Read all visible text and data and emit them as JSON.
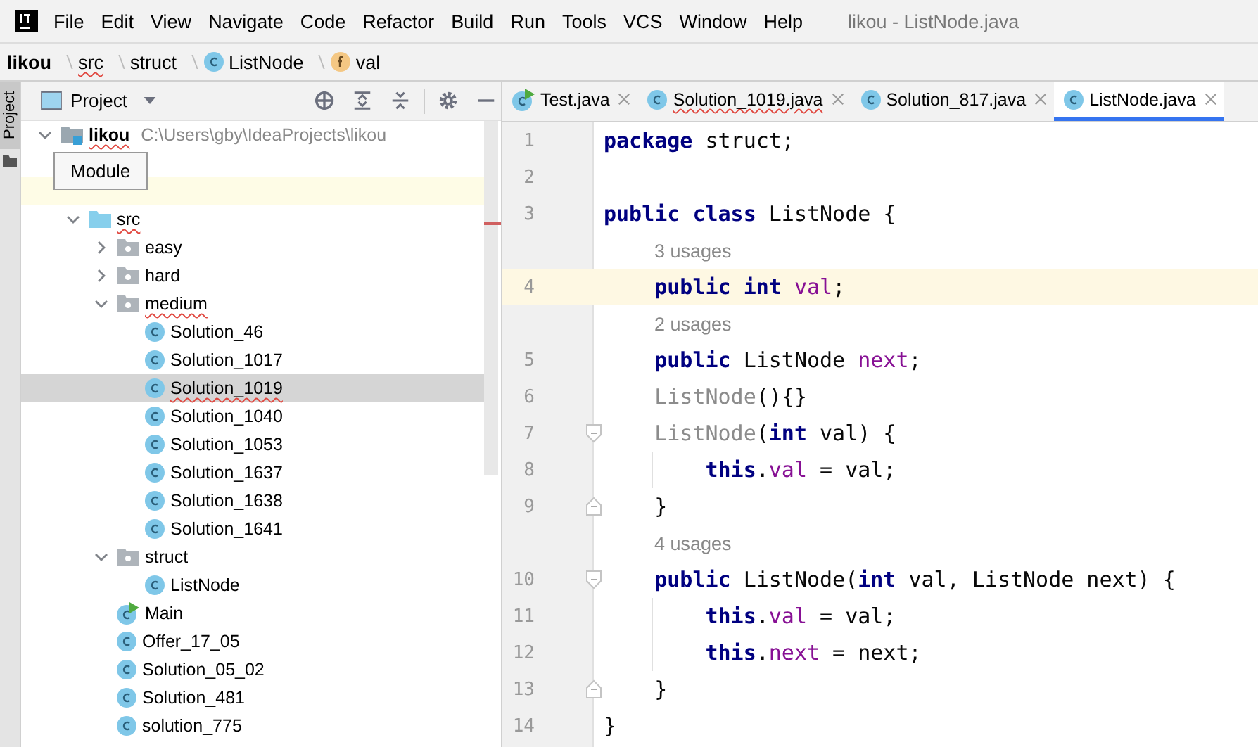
{
  "menu": [
    "File",
    "Edit",
    "View",
    "Navigate",
    "Code",
    "Refactor",
    "Build",
    "Run",
    "Tools",
    "VCS",
    "Window",
    "Help"
  ],
  "window": {
    "title": "likou - ListNode.java"
  },
  "breadcrumb": [
    {
      "label": "likou",
      "kind": "module",
      "error": false
    },
    {
      "label": "src",
      "kind": "folder",
      "error": true
    },
    {
      "label": "struct",
      "kind": "folder",
      "error": false
    },
    {
      "label": "ListNode",
      "kind": "class",
      "error": false
    },
    {
      "label": "val",
      "kind": "field",
      "error": false
    }
  ],
  "side_strip": {
    "label": "Project"
  },
  "project": {
    "title": "Project",
    "tooltip": "Module",
    "tree": [
      {
        "label": "likou",
        "path": "C:\\Users\\gby\\IdeaProjects\\likou",
        "kind": "module",
        "expanded": true,
        "selected": false,
        "error": true,
        "children": [
          {
            "kind": "covered",
            "highlighted": false
          },
          {
            "kind": "covered",
            "highlighted": true
          },
          {
            "label": "src",
            "kind": "source",
            "expanded": true,
            "selected": false,
            "error": true,
            "children": [
              {
                "label": "easy",
                "kind": "package",
                "expanded": false,
                "selected": false,
                "error": false
              },
              {
                "label": "hard",
                "kind": "package",
                "expanded": false,
                "selected": false,
                "error": false
              },
              {
                "label": "medium",
                "kind": "package",
                "expanded": true,
                "selected": false,
                "error": true,
                "children": [
                  {
                    "label": "Solution_46",
                    "kind": "class",
                    "selected": false,
                    "error": false
                  },
                  {
                    "label": "Solution_1017",
                    "kind": "class",
                    "selected": false,
                    "error": false
                  },
                  {
                    "label": "Solution_1019",
                    "kind": "class",
                    "selected": true,
                    "error": true
                  },
                  {
                    "label": "Solution_1040",
                    "kind": "class",
                    "selected": false,
                    "error": false
                  },
                  {
                    "label": "Solution_1053",
                    "kind": "class",
                    "selected": false,
                    "error": false
                  },
                  {
                    "label": "Solution_1637",
                    "kind": "class",
                    "selected": false,
                    "error": false
                  },
                  {
                    "label": "Solution_1638",
                    "kind": "class",
                    "selected": false,
                    "error": false
                  },
                  {
                    "label": "Solution_1641",
                    "kind": "class",
                    "selected": false,
                    "error": false
                  }
                ]
              },
              {
                "label": "struct",
                "kind": "package",
                "expanded": true,
                "selected": false,
                "error": false,
                "children": [
                  {
                    "label": "ListNode",
                    "kind": "class",
                    "selected": false,
                    "error": false
                  }
                ]
              },
              {
                "label": "Main",
                "kind": "main",
                "selected": false,
                "error": false
              },
              {
                "label": "Offer_17_05",
                "kind": "class",
                "selected": false,
                "error": false
              },
              {
                "label": "Solution_05_02",
                "kind": "class",
                "selected": false,
                "error": false
              },
              {
                "label": "Solution_481",
                "kind": "class",
                "selected": false,
                "error": false
              },
              {
                "label": "solution_775",
                "kind": "class",
                "selected": false,
                "error": false
              }
            ]
          }
        ]
      }
    ]
  },
  "tabs": [
    {
      "label": "Test.java",
      "kind": "main",
      "selected": false,
      "error": false
    },
    {
      "label": "Solution_1019.java",
      "kind": "class",
      "selected": false,
      "error": true
    },
    {
      "label": "Solution_817.java",
      "kind": "class",
      "selected": false,
      "error": false
    },
    {
      "label": "ListNode.java",
      "kind": "class",
      "selected": true,
      "error": false
    }
  ],
  "editor": {
    "lines": [
      {
        "kind": "code",
        "number": "1",
        "current": false,
        "tokens": [
          {
            "text": "package",
            "kind": "keyword"
          },
          {
            "text": " struct;",
            "kind": "plain"
          }
        ]
      },
      {
        "kind": "code",
        "number": "2",
        "current": false
      },
      {
        "kind": "code",
        "number": "3",
        "current": false,
        "tokens": [
          {
            "text": "public class",
            "kind": "keyword"
          },
          {
            "text": " ListNode {",
            "kind": "plain"
          }
        ]
      },
      {
        "kind": "hint",
        "text": "3 usages"
      },
      {
        "kind": "code",
        "number": "4",
        "current": true,
        "tokens": [
          {
            "text": "    public int",
            "kind": "keyword"
          },
          {
            "text": " val",
            "kind": "field"
          },
          {
            "text": ";",
            "kind": "plain"
          }
        ]
      },
      {
        "kind": "hint",
        "text": "2 usages"
      },
      {
        "kind": "code",
        "number": "5",
        "current": false,
        "tokens": [
          {
            "text": "    public",
            "kind": "keyword"
          },
          {
            "text": " ListNode ",
            "kind": "plain"
          },
          {
            "text": "next",
            "kind": "field"
          },
          {
            "text": ";",
            "kind": "plain"
          }
        ]
      },
      {
        "kind": "code",
        "number": "6",
        "current": false,
        "tokens": [
          {
            "text": "    ListNode",
            "kind": "unused"
          },
          {
            "text": "(){}",
            "kind": "plain"
          }
        ]
      },
      {
        "kind": "code",
        "number": "7",
        "current": false,
        "fold_start": true,
        "tokens": [
          {
            "text": "    ListNode",
            "kind": "unused"
          },
          {
            "text": "(",
            "kind": "plain"
          },
          {
            "text": "int",
            "kind": "keyword"
          },
          {
            "text": " val) {",
            "kind": "plain"
          }
        ]
      },
      {
        "kind": "code",
        "number": "8",
        "current": false,
        "guide": true,
        "tokens": [
          {
            "text": "        this",
            "kind": "keyword"
          },
          {
            "text": ".",
            "kind": "plain"
          },
          {
            "text": "val",
            "kind": "field"
          },
          {
            "text": " = val;",
            "kind": "plain"
          }
        ]
      },
      {
        "kind": "code",
        "number": "9",
        "current": false,
        "fold_end": true,
        "tokens": [
          {
            "text": "    }",
            "kind": "plain"
          }
        ]
      },
      {
        "kind": "hint",
        "text": "4 usages"
      },
      {
        "kind": "code",
        "number": "10",
        "current": false,
        "fold_start": true,
        "tokens": [
          {
            "text": "    public",
            "kind": "keyword"
          },
          {
            "text": " ListNode(",
            "kind": "plain"
          },
          {
            "text": "int",
            "kind": "keyword"
          },
          {
            "text": " val, ListNode next) {",
            "kind": "plain"
          }
        ]
      },
      {
        "kind": "code",
        "number": "11",
        "current": false,
        "guide": true,
        "tokens": [
          {
            "text": "        this",
            "kind": "keyword"
          },
          {
            "text": ".",
            "kind": "plain"
          },
          {
            "text": "val",
            "kind": "field"
          },
          {
            "text": " = val;",
            "kind": "plain"
          }
        ]
      },
      {
        "kind": "code",
        "number": "12",
        "current": false,
        "guide": true,
        "tokens": [
          {
            "text": "        this",
            "kind": "keyword"
          },
          {
            "text": ".",
            "kind": "plain"
          },
          {
            "text": "next",
            "kind": "field"
          },
          {
            "text": " = next;",
            "kind": "plain"
          }
        ]
      },
      {
        "kind": "code",
        "number": "13",
        "current": false,
        "fold_end": true,
        "tokens": [
          {
            "text": "    }",
            "kind": "plain"
          }
        ]
      },
      {
        "kind": "code",
        "number": "14",
        "current": false,
        "tokens": [
          {
            "text": "}",
            "kind": "plain"
          }
        ]
      }
    ]
  }
}
